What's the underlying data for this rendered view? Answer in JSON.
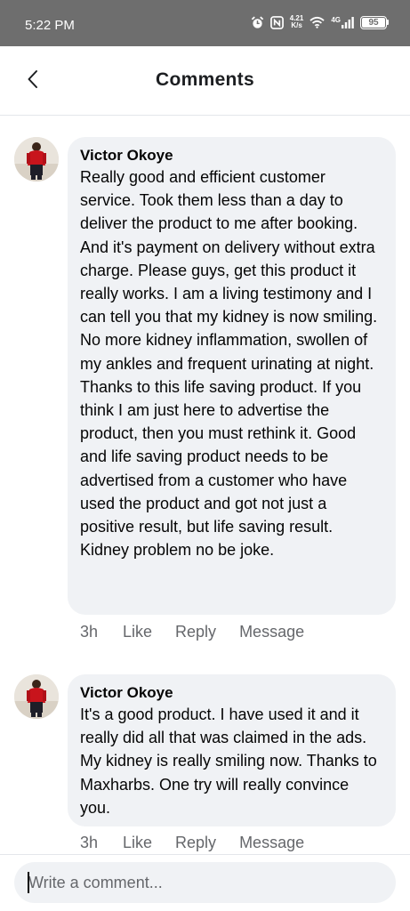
{
  "status_bar": {
    "time": "5:22 PM",
    "speed_value": "4.21",
    "speed_unit": "K/s",
    "network": "4G",
    "battery": "95",
    "icons": [
      "alarm-icon",
      "nfc-icon",
      "wifi-icon",
      "signal-icon",
      "battery-icon"
    ]
  },
  "header": {
    "title": "Comments",
    "back_icon": "chevron-left-icon"
  },
  "comments": [
    {
      "author": "Victor Okoye",
      "text": "Really good and efficient customer service. Took them less than a day to deliver the product to me after booking. And it's payment on delivery without extra charge. Please guys, get this product it really works. I am a living testimony and I can tell you that my kidney is now smiling. No more kidney inflammation, swollen of my ankles and frequent urinating at night. Thanks to this life saving product. If you think I am just here to advertise the product, then you must rethink it. Good and life saving product needs to be advertised from a customer who have used the product and got not just a positive result, but life saving result. Kidney problem no be joke.",
      "time": "3h",
      "like": "Like",
      "reply": "Reply",
      "message": "Message"
    },
    {
      "author": "Victor Okoye",
      "text": "It's a good product. I have used it and it really did all that was claimed in the ads. My kidney is really smiling now. Thanks to Maxharbs. One try will really convince you.",
      "time": "3h",
      "like": "Like",
      "reply": "Reply",
      "message": "Message"
    }
  ],
  "composer": {
    "placeholder": "Write a comment..."
  },
  "colors": {
    "status_bar_bg": "#6e6e6e",
    "bubble_bg": "#f0f2f5",
    "secondary_text": "#65676b",
    "primary_text": "#050505"
  }
}
